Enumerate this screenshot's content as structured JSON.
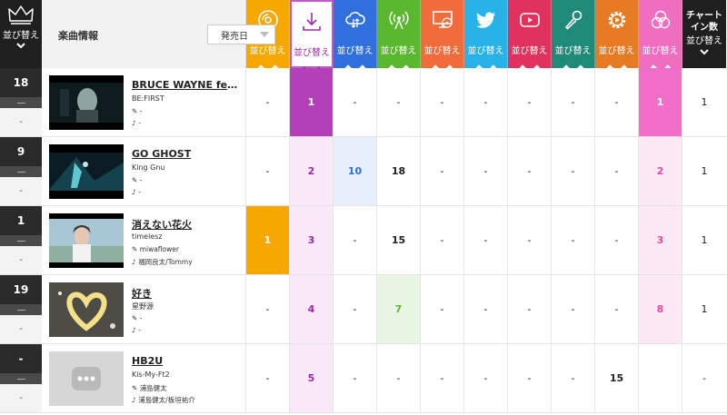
{
  "header": {
    "rank_label": "並び替え",
    "info_title": "楽曲情報",
    "sort_select": "発売日",
    "columns": [
      {
        "icon": "cd-icon",
        "label": "並び替え",
        "color": "#f7a800"
      },
      {
        "icon": "download-icon",
        "label": "並び替え",
        "color": "#ffffff",
        "selected": true
      },
      {
        "icon": "cloud-stream-icon",
        "label": "並び替え",
        "color": "#2f6fde"
      },
      {
        "icon": "radio-icon",
        "label": "並び替え",
        "color": "#5ab82e"
      },
      {
        "icon": "pc-disc-icon",
        "label": "並び替え",
        "color": "#f26b3a"
      },
      {
        "icon": "twitter-icon",
        "label": "並び替え",
        "color": "#27b3e8"
      },
      {
        "icon": "youtube-icon",
        "label": "並び替え",
        "color": "#e0325c"
      },
      {
        "icon": "karaoke-mic-icon",
        "label": "並び替え",
        "color": "#1f8a78"
      },
      {
        "icon": "gear-play-icon",
        "label": "並び替え",
        "color": "#e77b23"
      },
      {
        "icon": "circles-icon",
        "label": "並び替え",
        "color": "#f06ec0"
      }
    ],
    "chart_in_label": "チャートイン数",
    "chart_in_sub": "並び替え"
  },
  "rows": [
    {
      "rank": "18",
      "prev": "-",
      "title": "BRUCE WAYNE feat. …",
      "artist": "BE:FIRST",
      "writer": "-",
      "composer": "-",
      "values": [
        "-",
        "1",
        "-",
        "-",
        "-",
        "-",
        "-",
        "-",
        "-",
        "1"
      ],
      "chart_in": "1"
    },
    {
      "rank": "9",
      "prev": "-",
      "title": "GO GHOST",
      "artist": "King Gnu",
      "writer": "-",
      "composer": "-",
      "values": [
        "-",
        "2",
        "10",
        "18",
        "-",
        "-",
        "-",
        "-",
        "-",
        "2"
      ],
      "chart_in": "1"
    },
    {
      "rank": "1",
      "prev": "-",
      "title": "消えない花火",
      "artist": "timelesz",
      "writer": "miwaflower",
      "composer": "福岡良太/Tommy",
      "values": [
        "1",
        "3",
        "-",
        "15",
        "-",
        "-",
        "-",
        "-",
        "-",
        "3"
      ],
      "chart_in": "1"
    },
    {
      "rank": "19",
      "prev": "-",
      "title": "好き",
      "artist": "星野源",
      "writer": "-",
      "composer": "-",
      "values": [
        "-",
        "4",
        "-",
        "7",
        "-",
        "-",
        "-",
        "-",
        "-",
        "8"
      ],
      "chart_in": "1"
    },
    {
      "rank": "-",
      "prev": "-",
      "title": "HB2U",
      "artist": "Kis-My-Ft2",
      "writer": "浦島健太",
      "composer": "浦島健太/板垣祐介",
      "values": [
        "-",
        "5",
        "-",
        "-",
        "-",
        "-",
        "-",
        "-",
        "15",
        ""
      ],
      "chart_in": "-"
    }
  ]
}
